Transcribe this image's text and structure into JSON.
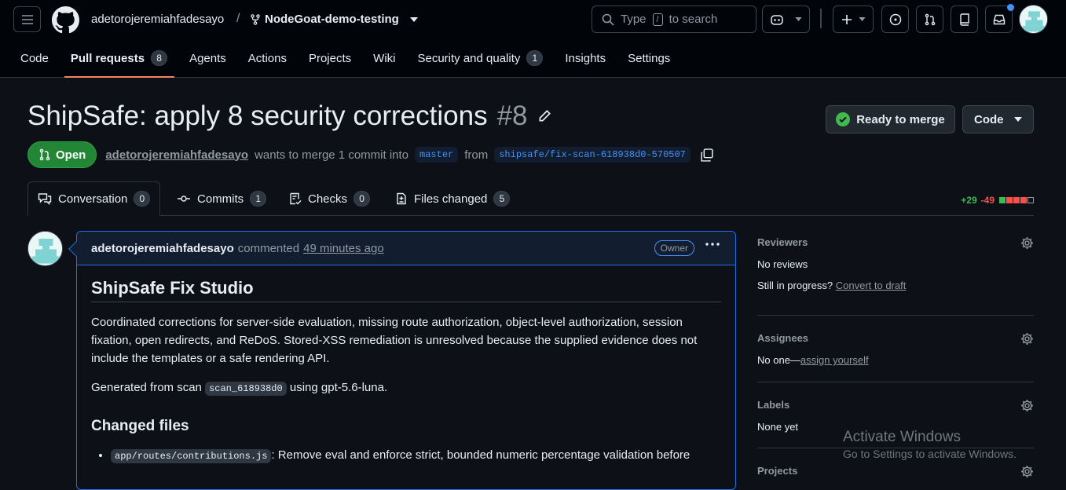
{
  "header": {
    "owner": "adetorojeremiahfadesayo",
    "separator": "/",
    "repo": "NodeGoat-demo-testing",
    "search_pre": "Type",
    "search_key": "/",
    "search_post": "to search"
  },
  "repo_tabs": [
    {
      "label": "Code",
      "count": null
    },
    {
      "label": "Pull requests",
      "count": "8"
    },
    {
      "label": "Agents",
      "count": null
    },
    {
      "label": "Actions",
      "count": null
    },
    {
      "label": "Projects",
      "count": null
    },
    {
      "label": "Wiki",
      "count": null
    },
    {
      "label": "Security and quality",
      "count": "1"
    },
    {
      "label": "Insights",
      "count": null
    },
    {
      "label": "Settings",
      "count": null
    }
  ],
  "pr": {
    "title": "ShipSafe: apply 8 security corrections",
    "number": "#8",
    "state": "Open",
    "author": "adetorojeremiahfadesayo",
    "merge_text": "wants to merge 1 commit into",
    "base": "master",
    "from": "from",
    "head": "shipsafe/fix-scan-618938d0-570507",
    "ready_label": "Ready to merge",
    "code_label": "Code"
  },
  "pr_tabs": [
    {
      "label": "Conversation",
      "count": "0"
    },
    {
      "label": "Commits",
      "count": "1"
    },
    {
      "label": "Checks",
      "count": "0"
    },
    {
      "label": "Files changed",
      "count": "5"
    }
  ],
  "diffstat": {
    "added": "+29",
    "removed": "-49"
  },
  "comment": {
    "author": "adetorojeremiahfadesayo",
    "verb": "commented",
    "time": "49 minutes ago",
    "badge": "Owner",
    "heading": "ShipSafe Fix Studio",
    "para1": "Coordinated corrections for server-side evaluation, missing route authorization, object-level authorization, session fixation, open redirects, and ReDoS. Stored-XSS remediation is unresolved because the supplied evidence does not include the templates or a safe rendering API.",
    "para2_pre": "Generated from scan",
    "para2_code": "scan_618938d0",
    "para2_post": "using gpt-5.6-luna.",
    "subheading": "Changed files",
    "item1_code": "app/routes/contributions.js",
    "item1_text": ": Remove eval and enforce strict, bounded numeric percentage validation before"
  },
  "sidebar": {
    "reviewers_h": "Reviewers",
    "reviewers_v": "No reviews",
    "progress_pre": "Still in progress?",
    "progress_link": "Convert to draft",
    "assignees_h": "Assignees",
    "assignees_pre": "No one—",
    "assignees_link": "assign yourself",
    "labels_h": "Labels",
    "labels_v": "None yet",
    "projects_h": "Projects"
  },
  "watermark": {
    "line1": "Activate Windows",
    "line2": "Go to Settings to activate Windows."
  },
  "colors": {
    "accent": "#4493f8",
    "open": "#238636",
    "tab_underline": "#f78166",
    "added": "#3fb950",
    "removed": "#f85149"
  }
}
